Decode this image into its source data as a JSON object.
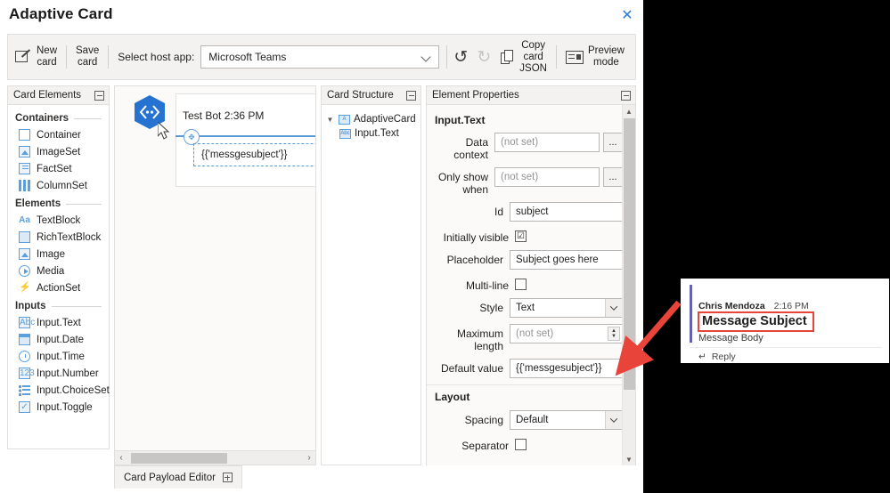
{
  "window": {
    "title": "Adaptive Card",
    "close_label": "✕"
  },
  "toolbar": {
    "new_card": "New\ncard",
    "save_card": "Save\ncard",
    "host_app_label": "Select host app:",
    "host_app_value": "Microsoft Teams",
    "undo": "↰",
    "redo": "↱",
    "copy_card_json": "Copy\ncard\nJSON",
    "preview_mode": "Preview\nmode"
  },
  "card_elements": {
    "header": "Card Elements",
    "groups": [
      {
        "name": "Containers",
        "items": [
          {
            "label": "Container",
            "icon": "container-icon"
          },
          {
            "label": "ImageSet",
            "icon": "imageset-icon"
          },
          {
            "label": "FactSet",
            "icon": "factset-icon"
          },
          {
            "label": "ColumnSet",
            "icon": "columnset-icon"
          }
        ]
      },
      {
        "name": "Elements",
        "items": [
          {
            "label": "TextBlock",
            "icon": "textblock-icon"
          },
          {
            "label": "RichTextBlock",
            "icon": "richtextblock-icon"
          },
          {
            "label": "Image",
            "icon": "image-icon"
          },
          {
            "label": "Media",
            "icon": "media-icon"
          },
          {
            "label": "ActionSet",
            "icon": "actionset-icon"
          }
        ]
      },
      {
        "name": "Inputs",
        "items": [
          {
            "label": "Input.Text",
            "icon": "input-text-icon"
          },
          {
            "label": "Input.Date",
            "icon": "input-date-icon"
          },
          {
            "label": "Input.Time",
            "icon": "input-time-icon"
          },
          {
            "label": "Input.Number",
            "icon": "input-number-icon"
          },
          {
            "label": "Input.ChoiceSet",
            "icon": "input-choiceset-icon"
          },
          {
            "label": "Input.Toggle",
            "icon": "input-toggle-icon"
          }
        ]
      }
    ]
  },
  "card_preview": {
    "sender": "Test Bot 2:36 PM",
    "input_value": "{{'messgesubject'}}"
  },
  "card_structure": {
    "header": "Card Structure",
    "root": "AdaptiveCard",
    "child": "Input.Text"
  },
  "element_properties": {
    "header": "Element Properties",
    "element_type": "Input.Text",
    "fields": {
      "data_context_label": "Data context",
      "data_context_value": "(not set)",
      "only_show_when_label": "Only show when",
      "only_show_when_value": "(not set)",
      "id_label": "Id",
      "id_value": "subject",
      "initially_visible_label": "Initially visible",
      "initially_visible_checked": "☑",
      "placeholder_label": "Placeholder",
      "placeholder_value": "Subject goes here",
      "multiline_label": "Multi-line",
      "style_label": "Style",
      "style_value": "Text",
      "max_length_label": "Maximum length",
      "max_length_value": "(not set)",
      "default_value_label": "Default value",
      "default_value_value": "{{'messgesubject'}}",
      "ellipsis": "..."
    },
    "layout_section": {
      "title": "Layout",
      "spacing_label": "Spacing",
      "spacing_value": "Default",
      "separator_label": "Separator"
    }
  },
  "bottom": {
    "payload_editor": "Card Payload Editor"
  },
  "teams_message": {
    "author": "Chris Mendoza",
    "time": "2:16 PM",
    "subject": "Message Subject",
    "body": "Message Body",
    "reply": "Reply"
  },
  "colors": {
    "accent_blue": "#2b7cd3",
    "icon_blue": "#5aa0e0",
    "teams_purple": "#6264a7",
    "highlight_red": "#e8443a",
    "panel_gray": "#f3f2f1"
  }
}
